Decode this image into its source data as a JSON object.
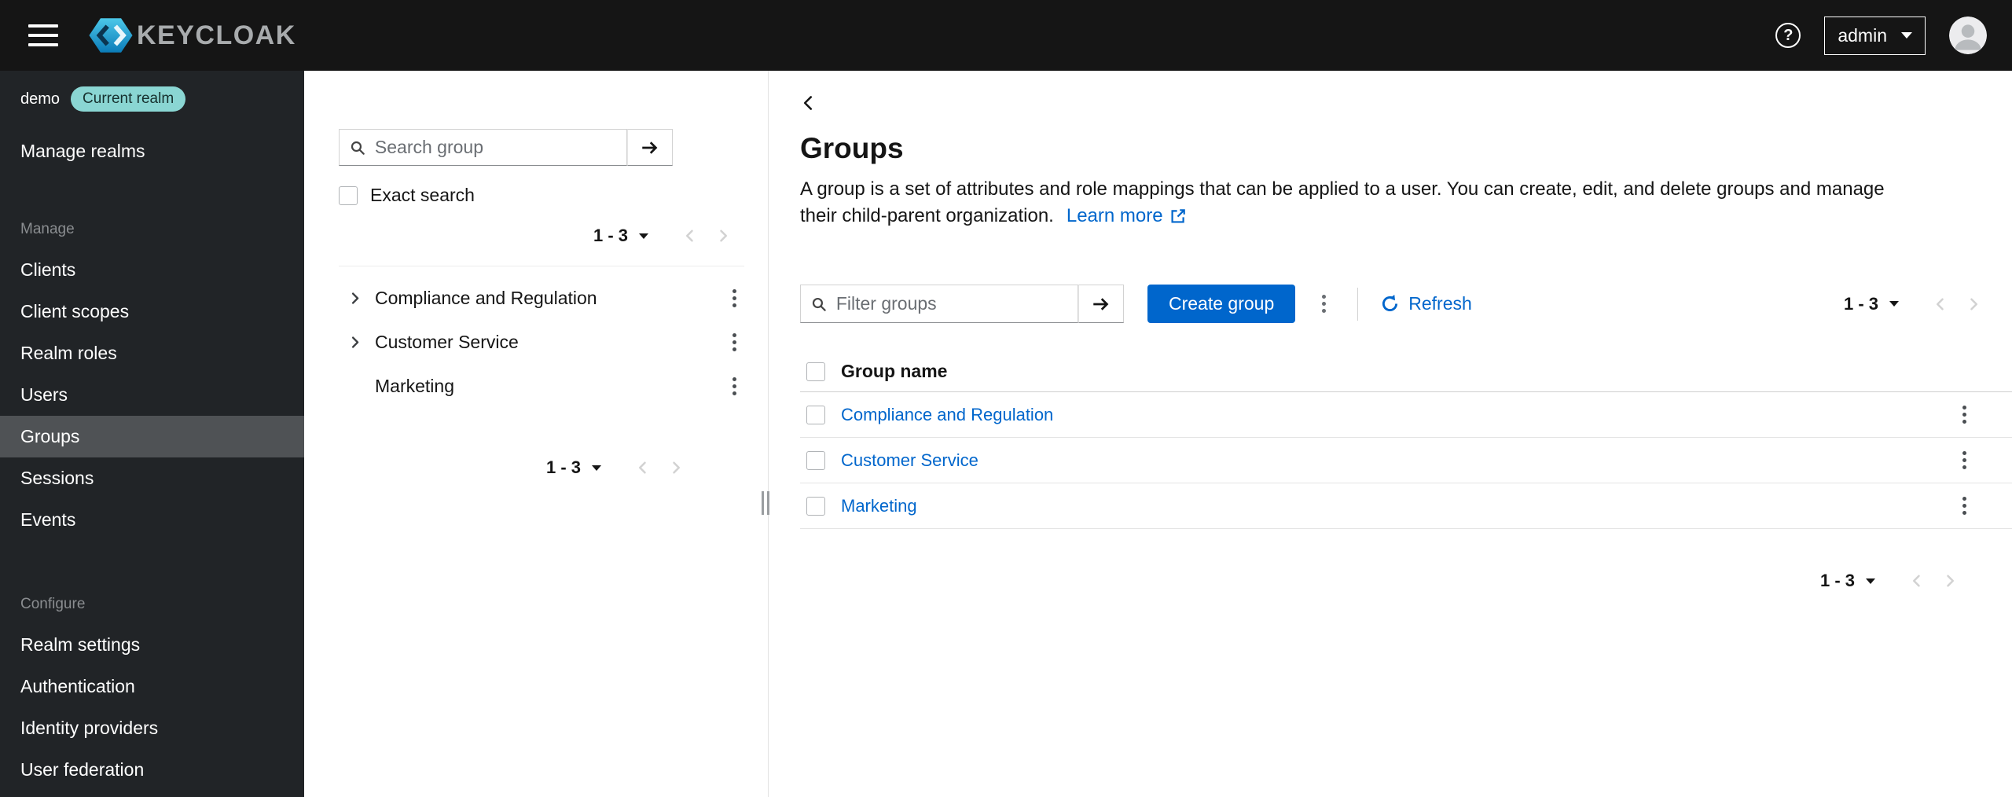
{
  "masthead": {
    "brand": "KEYCLOAK",
    "user_menu": {
      "label": "admin"
    }
  },
  "sidebar": {
    "realm_name": "demo",
    "realm_badge": "Current realm",
    "manage_realms_label": "Manage realms",
    "sections": [
      {
        "label": "Manage",
        "items": [
          {
            "label": "Clients",
            "selected": false
          },
          {
            "label": "Client scopes",
            "selected": false
          },
          {
            "label": "Realm roles",
            "selected": false
          },
          {
            "label": "Users",
            "selected": false
          },
          {
            "label": "Groups",
            "selected": true
          },
          {
            "label": "Sessions",
            "selected": false
          },
          {
            "label": "Events",
            "selected": false
          }
        ]
      },
      {
        "label": "Configure",
        "items": [
          {
            "label": "Realm settings",
            "selected": false
          },
          {
            "label": "Authentication",
            "selected": false
          },
          {
            "label": "Identity providers",
            "selected": false
          },
          {
            "label": "User federation",
            "selected": false
          }
        ]
      }
    ]
  },
  "tree_panel": {
    "search_placeholder": "Search group",
    "exact_search_label": "Exact search",
    "pagination_top": "1 - 3",
    "items": [
      {
        "label": "Compliance and Regulation",
        "expandable": true
      },
      {
        "label": "Customer Service",
        "expandable": true
      },
      {
        "label": "Marketing",
        "expandable": false
      }
    ],
    "pagination_bottom": "1 - 3"
  },
  "main": {
    "title": "Groups",
    "description": "A group is a set of attributes and role mappings that can be applied to a user. You can create, edit, and delete groups and manage their child-parent organization.",
    "learn_more_label": "Learn more",
    "toolbar": {
      "filter_placeholder": "Filter groups",
      "create_button_label": "Create group",
      "refresh_label": "Refresh",
      "pagination": "1 - 3"
    },
    "table": {
      "columns": [
        "Group name"
      ],
      "rows": [
        {
          "name": "Compliance and Regulation",
          "checked": false
        },
        {
          "name": "Customer Service",
          "checked": false
        },
        {
          "name": "Marketing",
          "checked": false
        }
      ]
    },
    "pagination_bottom": "1 - 3"
  },
  "colors": {
    "masthead_bg": "#151515",
    "sidebar_bg": "#212427",
    "sidebar_selected_bg": "#4f5255",
    "primary": "#0066cc",
    "link": "#0066cc",
    "badge_bg": "#8ad6d3",
    "border": "#d2d2d2"
  }
}
